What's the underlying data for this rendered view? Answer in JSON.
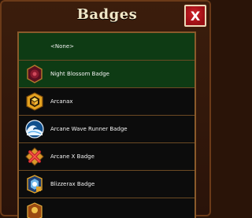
{
  "title": "Badges",
  "close_label": "X",
  "badges": [
    {
      "label": "<None>",
      "icon": null,
      "selected": true
    },
    {
      "label": "Night Blossom Badge",
      "icon": "night-blossom-badge-icon",
      "selected": true
    },
    {
      "label": "Arcanax",
      "icon": "arcanax-badge-icon",
      "selected": false
    },
    {
      "label": "Arcane Wave Runner Badge",
      "icon": "arcane-wave-runner-badge-icon",
      "selected": false
    },
    {
      "label": "Arcane X Badge",
      "icon": "arcane-x-badge-icon",
      "selected": false
    },
    {
      "label": "Blizzerax Badge",
      "icon": "blizzerax-badge-icon",
      "selected": false
    },
    {
      "label": "",
      "icon": "partial-badge-icon",
      "selected": false
    }
  ],
  "colors": {
    "selected_row": "#0e3b14",
    "unselected_row": "#0c0c0c",
    "close_button": "#c1171d"
  }
}
